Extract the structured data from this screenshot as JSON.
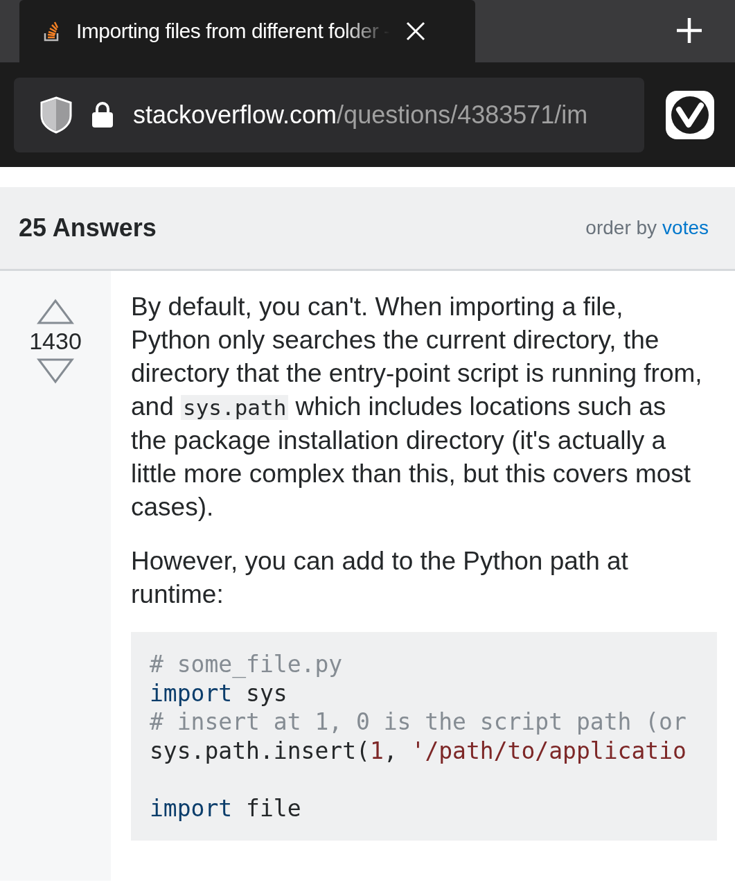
{
  "tab": {
    "title": "Importing files from different folder -",
    "selected": true
  },
  "address_bar": {
    "host": "stackoverflow.com",
    "path": "/questions/4383571/im"
  },
  "answers_header": {
    "title": "25 Answers",
    "order_label": "order by",
    "order_value": "votes"
  },
  "answer": {
    "score": "1430",
    "paragraphs": [
      [
        {
          "kind": "text",
          "text": "By default, you can't. When importing a file, Python only searches the current directory, the directory that the entry-point script is running from, and "
        },
        {
          "kind": "code",
          "text": "sys.path"
        },
        {
          "kind": "text",
          "text": " which includes locations such as the package installation directory (it's actually a little more complex than this, but this covers most cases)."
        }
      ],
      [
        {
          "kind": "text",
          "text": "However, you can add to the Python path at runtime:"
        }
      ]
    ],
    "code_lines": [
      {
        "kind": "code",
        "tokens": [
          {
            "kind": "comment",
            "text": "# some_file.py"
          }
        ]
      },
      {
        "kind": "code",
        "tokens": [
          {
            "kind": "keyword",
            "text": "import"
          },
          {
            "kind": "plain",
            "text": " sys"
          }
        ]
      },
      {
        "kind": "code",
        "tokens": [
          {
            "kind": "comment",
            "text": "# insert at 1, 0 is the script path (or"
          }
        ]
      },
      {
        "kind": "code",
        "tokens": [
          {
            "kind": "plain",
            "text": "sys.path.insert("
          },
          {
            "kind": "number",
            "text": "1"
          },
          {
            "kind": "plain",
            "text": ", "
          },
          {
            "kind": "string",
            "text": "'/path/to/applicatio"
          }
        ]
      },
      {
        "kind": "blank"
      },
      {
        "kind": "code",
        "tokens": [
          {
            "kind": "keyword",
            "text": "import"
          },
          {
            "kind": "plain",
            "text": " file"
          }
        ]
      }
    ]
  }
}
